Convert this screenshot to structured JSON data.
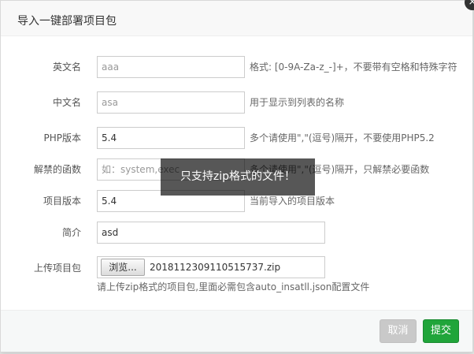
{
  "dialog": {
    "title": "导入一键部署项目包",
    "close_symbol": "×"
  },
  "form": {
    "english_name": {
      "label": "英文名",
      "placeholder": "aaa",
      "value": "",
      "hint": "格式: [0-9A-Za-z_-]+，不要带有空格和特殊字符"
    },
    "chinese_name": {
      "label": "中文名",
      "placeholder": "asa",
      "value": "",
      "hint": "用于显示到列表的名称"
    },
    "php_version": {
      "label": "PHP版本",
      "value": "5.4",
      "hint": "多个请使用\",\"(逗号)隔开，不要使用PHP5.2"
    },
    "disabled_functions": {
      "label": "解禁的函数",
      "placeholder": "如：system,exec",
      "hint": "多个请使用\",\"(逗号)隔开，只解禁必要函数"
    },
    "project_version": {
      "label": "项目版本",
      "value": "5.4",
      "hint": "当前导入的项目版本"
    },
    "description": {
      "label": "简介",
      "value": "asd"
    },
    "upload": {
      "label": "上传项目包",
      "browse_label": "浏览...",
      "file_name": "2018112309110515737.zip",
      "note": "请上传zip格式的项目包,里面必需包含auto_insatll.json配置文件"
    }
  },
  "buttons": {
    "cancel": "取消",
    "submit": "提交"
  },
  "toast": {
    "message": "只支持zip格式的文件！"
  },
  "colors": {
    "accent": "#20a53a",
    "cancel_bg": "#c9c9c9",
    "toast_bg": "rgba(0,0,0,0.66)"
  }
}
